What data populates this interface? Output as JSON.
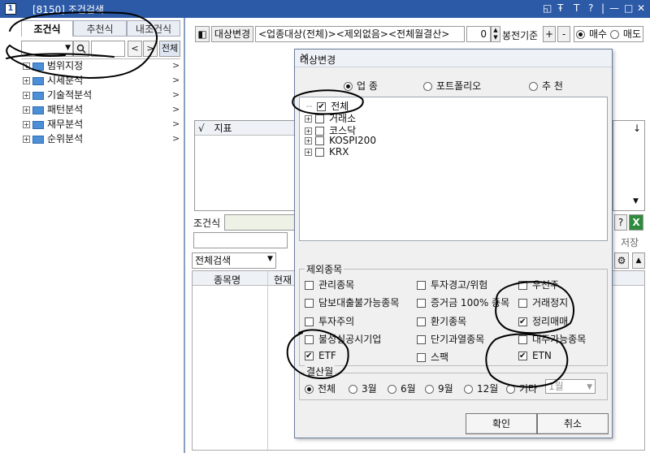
{
  "window": {
    "code": "[8150]",
    "title": "조건검색",
    "controls": [
      "◱",
      "Ŧ",
      "T",
      "?",
      "|",
      "—",
      "□",
      "✕"
    ]
  },
  "left": {
    "tabs": [
      "조건식",
      "추천식",
      "내조건식"
    ],
    "all_button": "전체",
    "tree": [
      "범위지정",
      "시세분석",
      "기술적분석",
      "패턴분석",
      "재무분석",
      "순위분석"
    ]
  },
  "right": {
    "target_change_label": "대상변경",
    "target_summary": "<업종대상(전체)><제외없음><전체월결산>",
    "bong_value": "0",
    "bong_label": "봉전기준",
    "plus": "+",
    "minus": "-",
    "buy_label": "매수",
    "sell_label": "매도",
    "indicator_check": "√",
    "indicator_header": "지표",
    "condition_label": "조건식",
    "save_label": "저장",
    "search_type": "전체검색",
    "col_stock": "종목명",
    "col_price": "현재",
    "help": "?"
  },
  "dialog": {
    "title": "대상변경",
    "scope_options": [
      {
        "label": "업 종",
        "selected": true
      },
      {
        "label": "포트폴리오",
        "selected": false
      },
      {
        "label": "추 천",
        "selected": false
      }
    ],
    "tree": [
      {
        "label": "전체",
        "checked": true,
        "expander": ""
      },
      {
        "label": "거래소",
        "checked": false,
        "expander": "+"
      },
      {
        "label": "코스닥",
        "checked": false,
        "expander": "+"
      },
      {
        "label": "KOSPI200",
        "checked": false,
        "expander": "+"
      },
      {
        "label": "KRX",
        "checked": false,
        "expander": "+"
      }
    ],
    "exclude_title": "제외종목",
    "exclude": [
      {
        "label": "관리종목",
        "checked": false
      },
      {
        "label": "투자경고/위험",
        "checked": false
      },
      {
        "label": "우선주",
        "checked": false
      },
      {
        "label": "담보대출불가능종목",
        "checked": false
      },
      {
        "label": "증거금 100% 종목",
        "checked": false
      },
      {
        "label": "거래정지",
        "checked": false
      },
      {
        "label": "투자주의",
        "checked": false
      },
      {
        "label": "환기종목",
        "checked": false
      },
      {
        "label": "정리매매",
        "checked": true
      },
      {
        "label": "불성실공시기업",
        "checked": false
      },
      {
        "label": "단기과열종목",
        "checked": false
      },
      {
        "label": "대주가능종목",
        "checked": false
      },
      {
        "label": "ETF",
        "checked": true
      },
      {
        "label": "스팩",
        "checked": false
      },
      {
        "label": "ETN",
        "checked": true
      }
    ],
    "settle_title": "결산월",
    "settle_options": [
      {
        "label": "전체",
        "selected": true
      },
      {
        "label": "3월",
        "selected": false
      },
      {
        "label": "6월",
        "selected": false
      },
      {
        "label": "9월",
        "selected": false
      },
      {
        "label": "12월",
        "selected": false
      },
      {
        "label": "기타",
        "selected": false
      }
    ],
    "other_month_value": "1월",
    "ok_label": "확인",
    "cancel_label": "취소"
  }
}
